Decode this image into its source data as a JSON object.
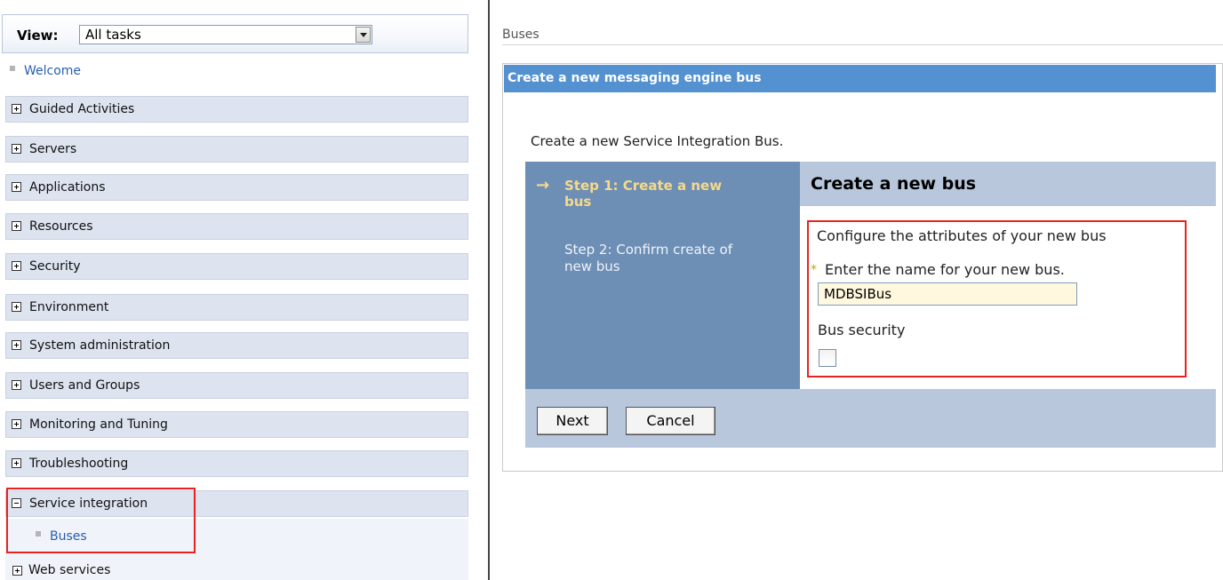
{
  "nav": {
    "view_label": "View:",
    "view_value": "All tasks",
    "welcome": "Welcome",
    "items": [
      {
        "label": "Guided Activities"
      },
      {
        "label": "Servers"
      },
      {
        "label": "Applications"
      },
      {
        "label": "Resources"
      },
      {
        "label": "Security"
      },
      {
        "label": "Environment"
      },
      {
        "label": "System administration"
      },
      {
        "label": "Users and Groups"
      },
      {
        "label": "Monitoring and Tuning"
      },
      {
        "label": "Troubleshooting"
      },
      {
        "label": "Service integration"
      }
    ],
    "sub_items": {
      "buses": "Buses",
      "web_services": "Web services"
    }
  },
  "content": {
    "breadcrumb": "Buses",
    "panel_title": "Create a new messaging engine bus",
    "intro": "Create a new Service Integration Bus.",
    "steps": {
      "step1": "Step 1: Create a new bus",
      "step2": "Step 2: Confirm create of new bus"
    },
    "form_title": "Create a new bus",
    "configure_text": "Configure the attributes of your new bus",
    "required_mark": "*",
    "name_label": "Enter the name for your new bus.",
    "name_value": "MDBSIBus",
    "security_label": "Bus security",
    "buttons": {
      "next": "Next",
      "cancel": "Cancel"
    }
  }
}
